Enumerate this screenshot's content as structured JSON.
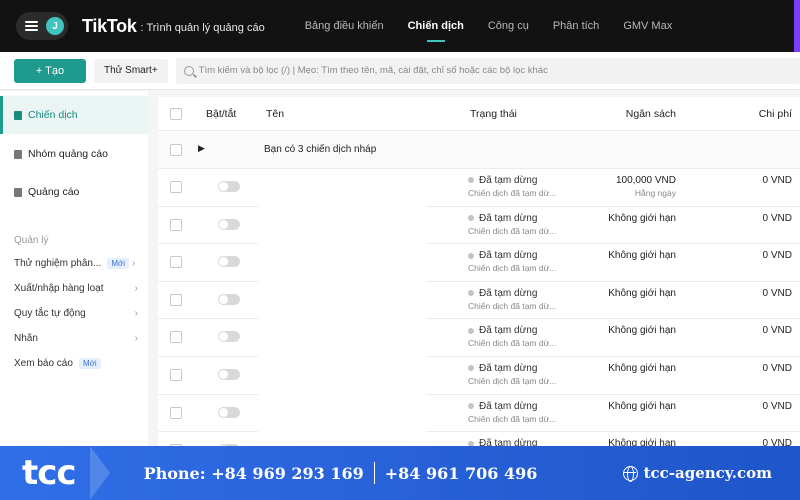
{
  "header": {
    "avatar_initial": "J",
    "brand": "TikTok",
    "brand_sub": ": Trình quản lý quảng cáo",
    "nav": [
      {
        "label": "Bảng điều khiển",
        "active": false
      },
      {
        "label": "Chiến dịch",
        "active": true
      },
      {
        "label": "Công cụ",
        "active": false
      },
      {
        "label": "Phân tích",
        "active": false
      },
      {
        "label": "GMV Max",
        "active": false
      }
    ]
  },
  "toolbar": {
    "create_label": "+ Tạo",
    "smart_label": "Thử Smart+",
    "search_placeholder": "Tìm kiếm và bộ lọc (/) | Mẹo: Tìm theo tên, mã, cài đặt, chỉ số hoặc các bộ lọc khác"
  },
  "sidebar": {
    "items": [
      {
        "label": "Chiến dịch",
        "active": true
      },
      {
        "label": "Nhóm quảng cáo",
        "active": false
      },
      {
        "label": "Quảng cáo",
        "active": false
      }
    ],
    "section_title": "Quản lý",
    "subitems": [
      {
        "label": "Thử nghiệm phân...",
        "badge": "Mới",
        "chevron": "›"
      },
      {
        "label": "Xuất/nhập hàng loạt",
        "badge": "",
        "chevron": "›"
      },
      {
        "label": "Quy tắc tự động",
        "badge": "",
        "chevron": "›"
      },
      {
        "label": "Nhãn",
        "badge": "",
        "chevron": "›"
      },
      {
        "label": "Xem báo cáo",
        "badge": "Mới",
        "chevron": ""
      }
    ]
  },
  "table": {
    "columns": {
      "toggle": "Bật/tắt",
      "name": "Tên",
      "status": "Trạng thái",
      "budget": "Ngân sách",
      "cost": "Chi phí"
    },
    "draft_text": "Bạn có 3 chiến dịch nháp",
    "rows": [
      {
        "status": "Đã tạm dừng",
        "status_sub": "Chiến dịch đã tạm dừ...",
        "budget": "100,000 VND",
        "budget_sub": "Hằng ngày",
        "cost": "0 VND"
      },
      {
        "status": "Đã tạm dừng",
        "status_sub": "Chiến dịch đã tạm dừ...",
        "budget": "Không giới hạn",
        "budget_sub": "",
        "cost": "0 VND"
      },
      {
        "status": "Đã tạm dừng",
        "status_sub": "Chiến dịch đã tạm dừ...",
        "budget": "Không giới hạn",
        "budget_sub": "",
        "cost": "0 VND"
      },
      {
        "status": "Đã tạm dừng",
        "status_sub": "Chiến dịch đã tạm dừ...",
        "budget": "Không giới hạn",
        "budget_sub": "",
        "cost": "0 VND"
      },
      {
        "status": "Đã tạm dừng",
        "status_sub": "Chiến dịch đã tạm dừ...",
        "budget": "Không giới hạn",
        "budget_sub": "",
        "cost": "0 VND"
      },
      {
        "status": "Đã tạm dừng",
        "status_sub": "Chiến dịch đã tạm dừ...",
        "budget": "Không giới hạn",
        "budget_sub": "",
        "cost": "0 VND"
      },
      {
        "status": "Đã tạm dừng",
        "status_sub": "Chiến dịch đã tạm dừ...",
        "budget": "Không giới hạn",
        "budget_sub": "",
        "cost": "0 VND"
      },
      {
        "status": "Đã tạm dừng",
        "status_sub": "",
        "budget": "Không giới hạn",
        "budget_sub": "",
        "cost": "0 VND"
      }
    ]
  },
  "footer": {
    "logo": "tcc",
    "phone_1": "Phone: +84 969 293 169",
    "phone_2": "+84 961 706 496",
    "website": "tcc-agency.com"
  },
  "colors": {
    "accent": "#1f9a8f",
    "nav_bg": "#121212",
    "footer_blue": "#2a64db"
  }
}
